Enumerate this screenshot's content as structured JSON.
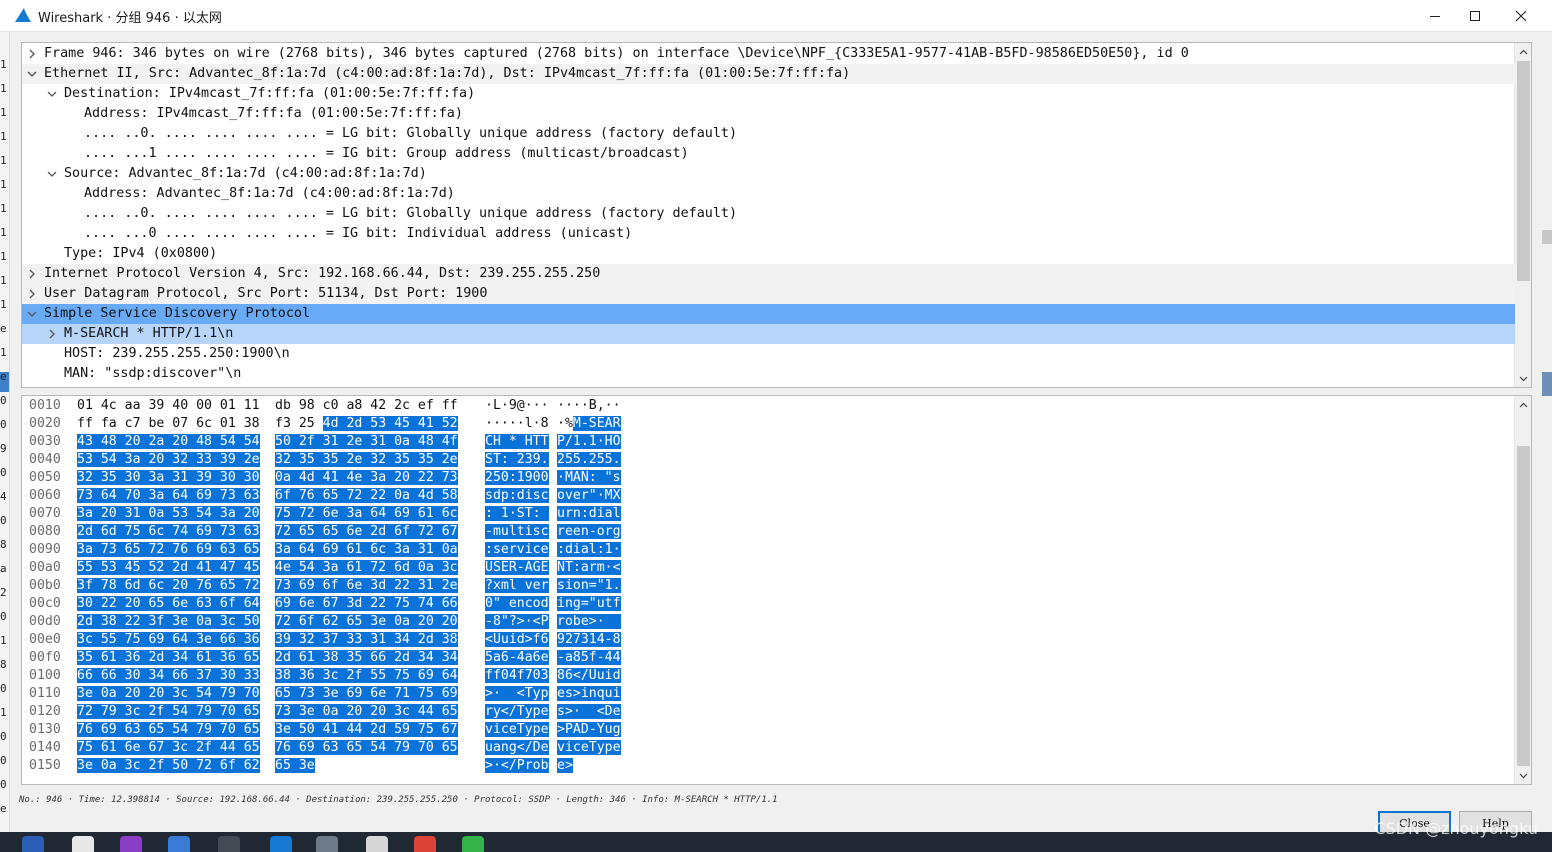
{
  "window": {
    "title": "Wireshark · 分组 946 · 以太网",
    "minimize_icon": "minimize-icon",
    "maximize_icon": "maximize-icon",
    "close_icon": "close-icon"
  },
  "tree": {
    "rows": [
      {
        "text": "Frame 946: 346 bytes on wire (2768 bits), 346 bytes captured (2768 bits) on interface \\Device\\NPF_{C333E5A1-9577-41AB-B5FD-98586ED50E50}, id 0",
        "expander": "collapsed"
      },
      {
        "text": "Ethernet II, Src: Advantec_8f:1a:7d (c4:00:ad:8f:1a:7d), Dst: IPv4mcast_7f:ff:fa (01:00:5e:7f:ff:fa)",
        "expander": "expanded"
      },
      {
        "text": "Destination: IPv4mcast_7f:ff:fa (01:00:5e:7f:ff:fa)",
        "expander": "expanded"
      },
      {
        "text": "Address: IPv4mcast_7f:ff:fa (01:00:5e:7f:ff:fa)",
        "expander": "none"
      },
      {
        "text": ".... ..0. .... .... .... .... = LG bit: Globally unique address (factory default)",
        "expander": "none"
      },
      {
        "text": ".... ...1 .... .... .... .... = IG bit: Group address (multicast/broadcast)",
        "expander": "none"
      },
      {
        "text": "Source: Advantec_8f:1a:7d (c4:00:ad:8f:1a:7d)",
        "expander": "expanded"
      },
      {
        "text": "Address: Advantec_8f:1a:7d (c4:00:ad:8f:1a:7d)",
        "expander": "none"
      },
      {
        "text": ".... ..0. .... .... .... .... = LG bit: Globally unique address (factory default)",
        "expander": "none"
      },
      {
        "text": ".... ...0 .... .... .... .... = IG bit: Individual address (unicast)",
        "expander": "none"
      },
      {
        "text": "Type: IPv4 (0x0800)",
        "expander": "none"
      },
      {
        "text": "Internet Protocol Version 4, Src: 192.168.66.44, Dst: 239.255.255.250",
        "expander": "collapsed"
      },
      {
        "text": "User Datagram Protocol, Src Port: 51134, Dst Port: 1900",
        "expander": "collapsed"
      },
      {
        "text": "Simple Service Discovery Protocol",
        "expander": "expanded"
      },
      {
        "text": "M-SEARCH * HTTP/1.1\\n",
        "expander": "collapsed"
      },
      {
        "text": "HOST: 239.255.255.250:1900\\n",
        "expander": "none"
      },
      {
        "text": "MAN: \"ssdp:discover\"\\n",
        "expander": "none"
      }
    ]
  },
  "hex": {
    "rows": [
      {
        "off": "0010",
        "h1": "01 4c aa 39 40 00 01 11",
        "h2": "db 98 c0 a8 42 2c ef ff",
        "a1": "·L·9@···",
        "a2": "····B,··"
      },
      {
        "off": "0020",
        "h1": "ff fa c7 be 07 6c 01 38",
        "h2": "f3 25 4d 2d 53 45 41 52",
        "a1": "·····l·8",
        "a2": "·%M-SEAR"
      },
      {
        "off": "0030",
        "h1": "43 48 20 2a 20 48 54 54",
        "h2": "50 2f 31 2e 31 0a 48 4f",
        "a1": "CH * HTT",
        "a2": "P/1.1·HO"
      },
      {
        "off": "0040",
        "h1": "53 54 3a 20 32 33 39 2e",
        "h2": "32 35 35 2e 32 35 35 2e",
        "a1": "ST: 239.",
        "a2": "255.255."
      },
      {
        "off": "0050",
        "h1": "32 35 30 3a 31 39 30 30",
        "h2": "0a 4d 41 4e 3a 20 22 73",
        "a1": "250:1900",
        "a2": "·MAN: \"s"
      },
      {
        "off": "0060",
        "h1": "73 64 70 3a 64 69 73 63",
        "h2": "6f 76 65 72 22 0a 4d 58",
        "a1": "sdp:disc",
        "a2": "over\"·MX"
      },
      {
        "off": "0070",
        "h1": "3a 20 31 0a 53 54 3a 20",
        "h2": "75 72 6e 3a 64 69 61 6c",
        "a1": ": 1·ST: ",
        "a2": "urn:dial"
      },
      {
        "off": "0080",
        "h1": "2d 6d 75 6c 74 69 73 63",
        "h2": "72 65 65 6e 2d 6f 72 67",
        "a1": "-multisc",
        "a2": "reen-org"
      },
      {
        "off": "0090",
        "h1": "3a 73 65 72 76 69 63 65",
        "h2": "3a 64 69 61 6c 3a 31 0a",
        "a1": ":service",
        "a2": ":dial:1·"
      },
      {
        "off": "00a0",
        "h1": "55 53 45 52 2d 41 47 45",
        "h2": "4e 54 3a 61 72 6d 0a 3c",
        "a1": "USER-AGE",
        "a2": "NT:arm·<"
      },
      {
        "off": "00b0",
        "h1": "3f 78 6d 6c 20 76 65 72",
        "h2": "73 69 6f 6e 3d 22 31 2e",
        "a1": "?xml ver",
        "a2": "sion=\"1."
      },
      {
        "off": "00c0",
        "h1": "30 22 20 65 6e 63 6f 64",
        "h2": "69 6e 67 3d 22 75 74 66",
        "a1": "0\" encod",
        "a2": "ing=\"utf"
      },
      {
        "off": "00d0",
        "h1": "2d 38 22 3f 3e 0a 3c 50",
        "h2": "72 6f 62 65 3e 0a 20 20",
        "a1": "-8\"?>·<P",
        "a2": "robe>·  "
      },
      {
        "off": "00e0",
        "h1": "3c 55 75 69 64 3e 66 36",
        "h2": "39 32 37 33 31 34 2d 38",
        "a1": "<Uuid>f6",
        "a2": "927314-8"
      },
      {
        "off": "00f0",
        "h1": "35 61 36 2d 34 61 36 65",
        "h2": "2d 61 38 35 66 2d 34 34",
        "a1": "5a6-4a6e",
        "a2": "-a85f-44"
      },
      {
        "off": "0100",
        "h1": "66 66 30 34 66 37 30 33",
        "h2": "38 36 3c 2f 55 75 69 64",
        "a1": "ff04f703",
        "a2": "86</Uuid"
      },
      {
        "off": "0110",
        "h1": "3e 0a 20 20 3c 54 79 70",
        "h2": "65 73 3e 69 6e 71 75 69",
        "a1": ">·  <Typ",
        "a2": "es>inqui"
      },
      {
        "off": "0120",
        "h1": "72 79 3c 2f 54 79 70 65",
        "h2": "73 3e 0a 20 20 3c 44 65",
        "a1": "ry</Type",
        "a2": "s>·  <De"
      },
      {
        "off": "0130",
        "h1": "76 69 63 65 54 79 70 65",
        "h2": "3e 50 41 44 2d 59 75 67",
        "a1": "viceType",
        "a2": ">PAD-Yug"
      },
      {
        "off": "0140",
        "h1": "75 61 6e 67 3c 2f 44 65",
        "h2": "76 69 63 65 54 79 70 65",
        "a1": "uang</De",
        "a2": "viceType"
      },
      {
        "off": "0150",
        "h1": "3e 0a 3c 2f 50 72 6f 62",
        "h2": "65 3e",
        "a1": ">·</Prob",
        "a2": "e>"
      }
    ]
  },
  "status": {
    "text": "No.: 946 · Time: 12.398814 · Source: 192.168.66.44 · Destination: 239.255.255.250 · Protocol: SSDP · Length: 346 · Info: M-SEARCH * HTTP/1.1"
  },
  "buttons": {
    "close": "Close",
    "help": "Help"
  },
  "background_window": {
    "left_chars": [
      "1",
      "1",
      "1",
      "1",
      "1",
      "1",
      "1",
      "1",
      "1",
      "1",
      "1",
      "e",
      "1",
      "e",
      "0",
      "0",
      "9",
      "0",
      "4",
      "0",
      "8",
      "a",
      "2",
      "0",
      "1",
      "8",
      "0",
      "1",
      "0",
      "0",
      "0",
      "e"
    ]
  },
  "taskbar": {
    "icons": [
      "word-icon",
      "chrome-icon",
      "visual-studio-icon",
      "browser-icon",
      "terminal-icon",
      "wireshark-icon",
      "image-viewer-icon",
      "notepad-icon",
      "chrome-icon",
      "wechat-icon"
    ]
  },
  "watermark": "CSDN @zhouyongku",
  "colors": {
    "selected_row": "#68aaf5",
    "sub_selected_row": "#b6d5f9",
    "hex_highlight": "#0a73d9"
  }
}
